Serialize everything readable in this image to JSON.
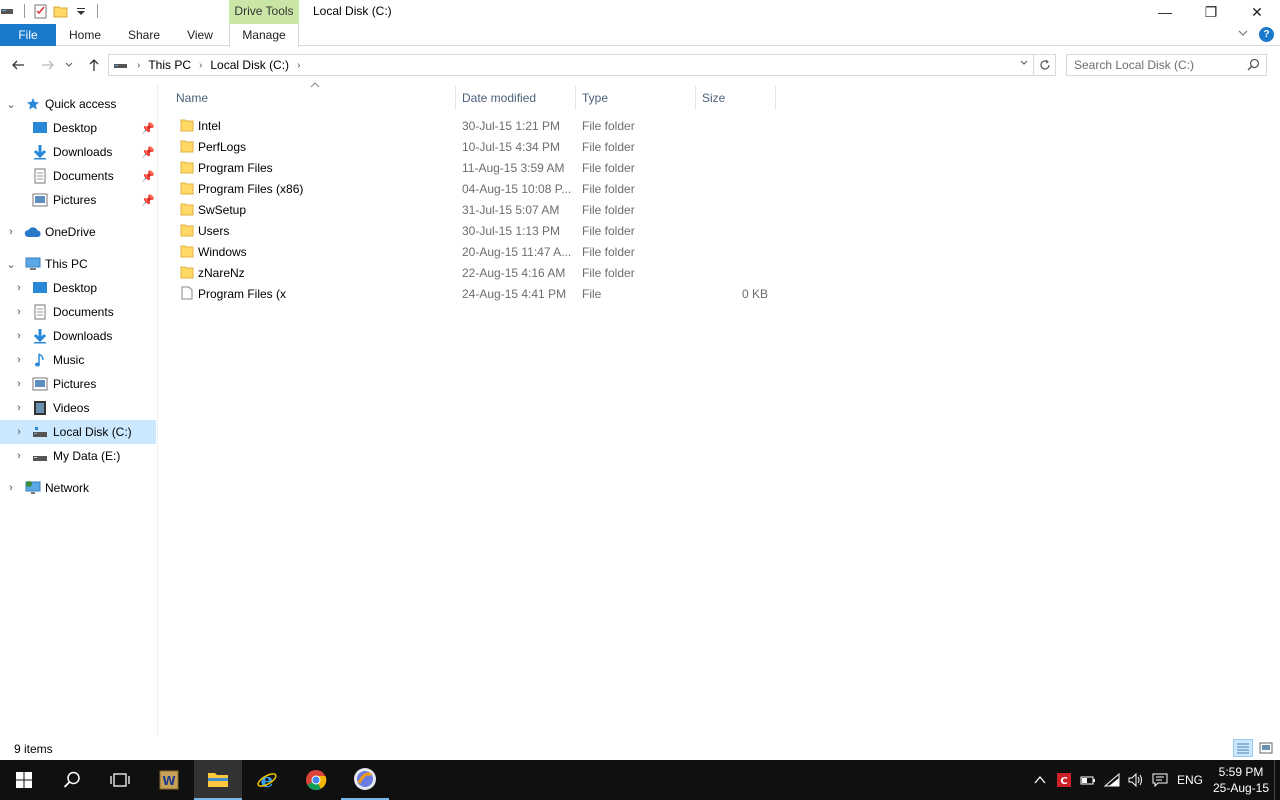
{
  "window": {
    "title": "Local Disk (C:)",
    "contextual_tab_group": "Drive Tools",
    "caption_buttons": {
      "minimize": "—",
      "restore": "❐",
      "close": "✕"
    }
  },
  "ribbon": {
    "tabs": {
      "file": "File",
      "home": "Home",
      "share": "Share",
      "view": "View",
      "manage": "Manage"
    },
    "help": "?"
  },
  "address": {
    "breadcrumbs": [
      "This PC",
      "Local Disk (C:)"
    ],
    "search_placeholder": "Search Local Disk (C:)"
  },
  "nav": {
    "quick_access": {
      "label": "Quick access",
      "items": [
        {
          "label": "Desktop",
          "icon": "desktop-icon"
        },
        {
          "label": "Downloads",
          "icon": "downloads-icon"
        },
        {
          "label": "Documents",
          "icon": "documents-icon"
        },
        {
          "label": "Pictures",
          "icon": "pictures-icon"
        }
      ]
    },
    "onedrive": "OneDrive",
    "this_pc": {
      "label": "This PC",
      "items": [
        {
          "label": "Desktop",
          "icon": "desktop-icon"
        },
        {
          "label": "Documents",
          "icon": "documents-icon"
        },
        {
          "label": "Downloads",
          "icon": "downloads-icon"
        },
        {
          "label": "Music",
          "icon": "music-icon"
        },
        {
          "label": "Pictures",
          "icon": "pictures-icon"
        },
        {
          "label": "Videos",
          "icon": "videos-icon"
        },
        {
          "label": "Local Disk (C:)",
          "icon": "local-disk-icon"
        },
        {
          "label": "My Data (E:)",
          "icon": "drive-icon"
        }
      ]
    },
    "network": "Network"
  },
  "columns": {
    "name": "Name",
    "date": "Date modified",
    "type": "Type",
    "size": "Size"
  },
  "files": [
    {
      "name": "Intel",
      "date": "30-Jul-15 1:21 PM",
      "type": "File folder",
      "size": ""
    },
    {
      "name": "PerfLogs",
      "date": "10-Jul-15 4:34 PM",
      "type": "File folder",
      "size": ""
    },
    {
      "name": "Program Files",
      "date": "11-Aug-15 3:59 AM",
      "type": "File folder",
      "size": ""
    },
    {
      "name": "Program Files (x86)",
      "date": "04-Aug-15 10:08 P...",
      "type": "File folder",
      "size": ""
    },
    {
      "name": "SwSetup",
      "date": "31-Jul-15 5:07 AM",
      "type": "File folder",
      "size": ""
    },
    {
      "name": "Users",
      "date": "30-Jul-15 1:13 PM",
      "type": "File folder",
      "size": ""
    },
    {
      "name": "Windows",
      "date": "20-Aug-15 11:47 A...",
      "type": "File folder",
      "size": ""
    },
    {
      "name": "zNareNz",
      "date": "22-Aug-15 4:16 AM",
      "type": "File folder",
      "size": ""
    },
    {
      "name": "Program Files (x",
      "date": "24-Aug-15 4:41 PM",
      "type": "File",
      "size": "0 KB"
    }
  ],
  "status": {
    "item_count": "9 items"
  },
  "taskbar": {
    "tray": {
      "language": "ENG",
      "time": "5:59 PM",
      "date": "25-Aug-15"
    }
  }
}
